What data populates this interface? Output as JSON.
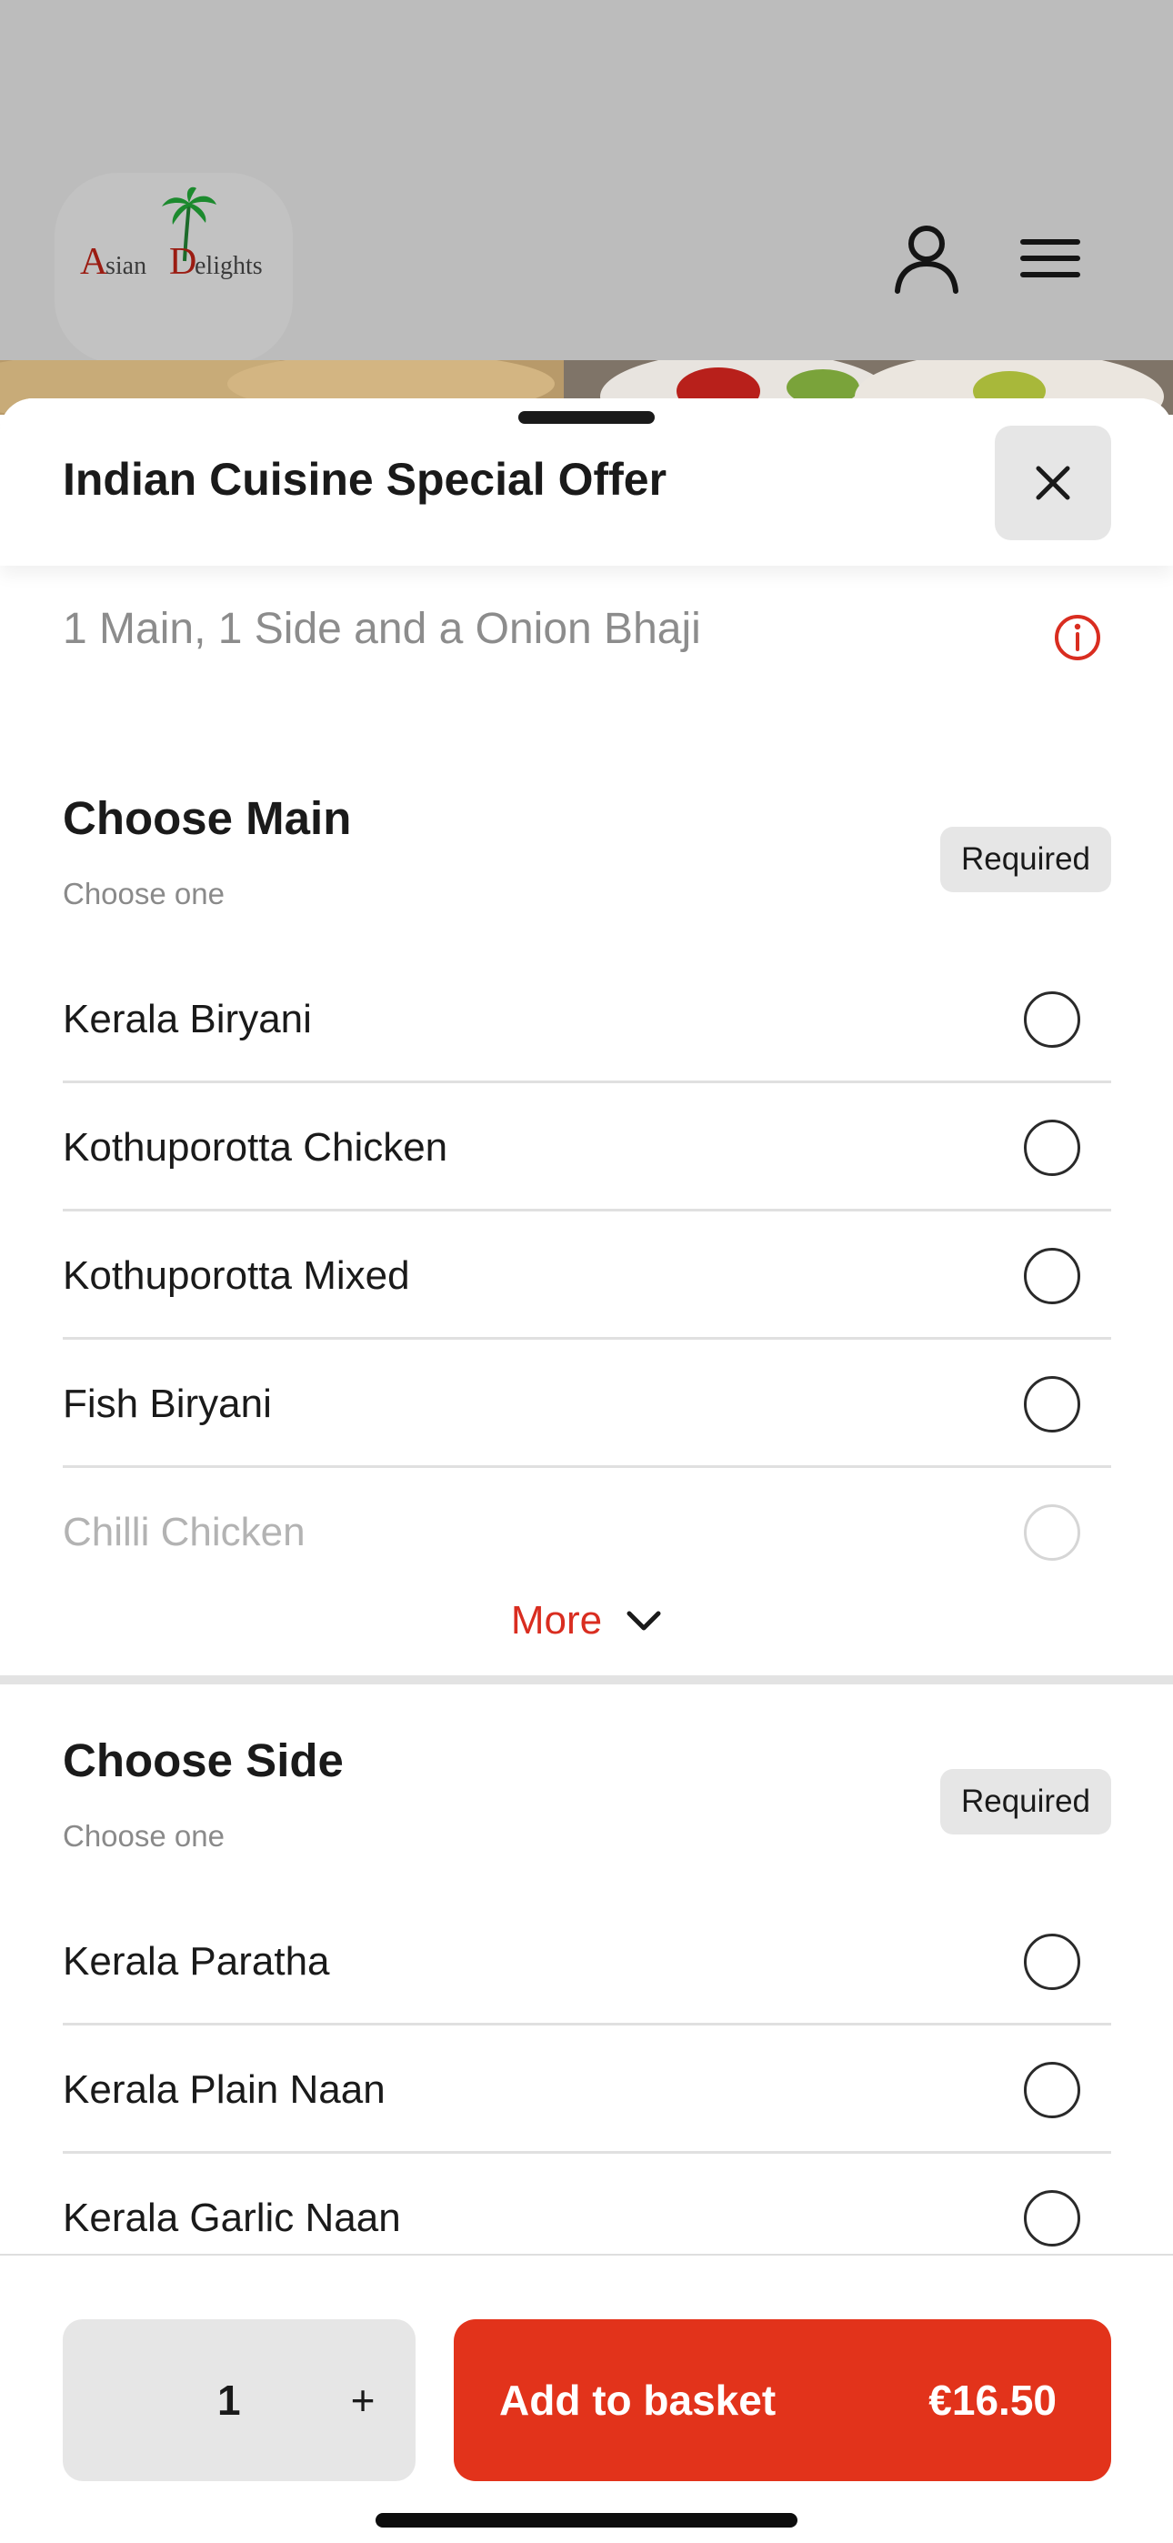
{
  "brand": {
    "logo_text": "Asian Delights",
    "logo_letters": [
      "A",
      "sian ",
      "D",
      "elights"
    ]
  },
  "header": {
    "account_icon": "person-icon",
    "menu_icon": "hamburger-menu-icon"
  },
  "sheet": {
    "title": "Indian Cuisine Special Offer",
    "close_icon": "close-icon",
    "description": "1 Main, 1 Side and a Onion Bhaji",
    "info_icon": "info-circle-icon"
  },
  "groups": [
    {
      "title": "Choose Main",
      "subtitle": "Choose one",
      "badge": "Required",
      "options": [
        {
          "name": "Kerala Biryani",
          "selected": false
        },
        {
          "name": "Kothuporotta Chicken",
          "selected": false
        },
        {
          "name": "Kothuporotta Mixed",
          "selected": false
        },
        {
          "name": "Fish Biryani",
          "selected": false
        },
        {
          "name": "Chilli Chicken",
          "selected": false
        }
      ],
      "more_label": "More",
      "more_icon": "chevron-down-icon"
    },
    {
      "title": "Choose Side",
      "subtitle": "Choose one",
      "badge": "Required",
      "options": [
        {
          "name": "Kerala Paratha",
          "selected": false
        },
        {
          "name": "Kerala Plain Naan",
          "selected": false
        },
        {
          "name": "Kerala Garlic Naan",
          "selected": false
        }
      ]
    }
  ],
  "footer": {
    "quantity": "1",
    "plus_label": "+",
    "add_label": "Add to basket",
    "price": "€16.50"
  },
  "colors": {
    "accent": "#e2331b",
    "accent_text": "#d92d20",
    "badge_bg": "#e6e6e6",
    "overlay": "#bcbcbc"
  }
}
